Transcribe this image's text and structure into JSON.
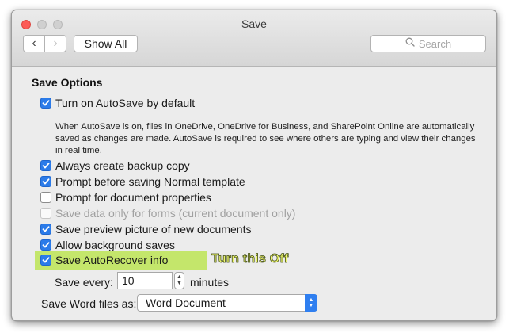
{
  "window": {
    "title": "Save"
  },
  "toolbar": {
    "back_glyph": "‹",
    "forward_glyph": "›",
    "show_all_label": "Show All",
    "search_placeholder": "Search"
  },
  "save_options": {
    "heading": "Save Options",
    "autosave": {
      "label": "Turn on AutoSave by default",
      "checked": true,
      "description": "When AutoSave is on, files in OneDrive, OneDrive for Business, and SharePoint Online are automatically saved as changes are made. AutoSave is required to see where others are typing and view their changes in real time."
    },
    "options": [
      {
        "label": "Always create backup copy",
        "checked": true,
        "enabled": true
      },
      {
        "label": "Prompt before saving Normal template",
        "checked": true,
        "enabled": true
      },
      {
        "label": "Prompt for document properties",
        "checked": false,
        "enabled": true
      },
      {
        "label": "Save data only for forms (current document only)",
        "checked": false,
        "enabled": false
      },
      {
        "label": "Save preview picture of new documents",
        "checked": true,
        "enabled": true
      },
      {
        "label": "Allow background saves",
        "checked": true,
        "enabled": true
      },
      {
        "label": "Save AutoRecover info",
        "checked": true,
        "enabled": true
      }
    ],
    "annotation": "Turn this Off",
    "save_every": {
      "label": "Save every:",
      "value": "10",
      "unit": "minutes"
    },
    "save_word_files_as": {
      "label": "Save Word files as:",
      "selected": "Word Document"
    }
  },
  "colors": {
    "accent": "#2b7be9",
    "highlight": "#c4e66b",
    "annotation_text": "#eef76e",
    "close_button": "#fc5b57"
  }
}
